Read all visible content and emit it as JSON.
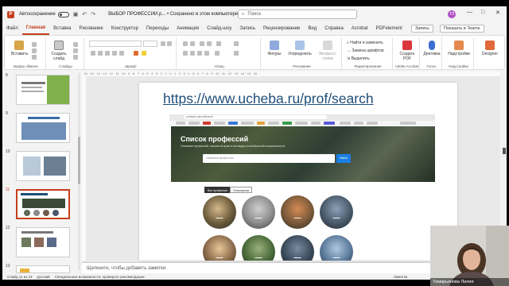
{
  "titlebar": {
    "autosave_label": "Автосохранение",
    "doc_title": "ВЫБОР ПРОФЕССИИ.p... • Сохранено в этом компьютере",
    "search_placeholder": "Поиск",
    "avatar_initials": "ТЛ"
  },
  "tabs": [
    "Файл",
    "Главная",
    "Вставка",
    "Рисование",
    "Конструктор",
    "Переходы",
    "Анимация",
    "Слайд-шоу",
    "Запись",
    "Рецензирование",
    "Вид",
    "Справка",
    "Acrobat",
    "PDFelement"
  ],
  "active_tab": "Главная",
  "tab_actions": {
    "record": "Запись",
    "present": "Показать в Teams"
  },
  "ribbon": {
    "paste": "Вставить",
    "new_slide": "Создать слайд",
    "shapes": "Фигуры",
    "arrange": "Упорядочить",
    "express_styles": "Экспресс-стили",
    "find": "Найти и заменить",
    "replace_fonts": "Замена шрифтов",
    "select": "Выделить",
    "create_pdf": "Создать PDF",
    "dictation": "Диктовка",
    "addins": "Надстройки",
    "designer": "Designer",
    "groups": {
      "clipboard": "Буфер обмена",
      "slides": "Слайды",
      "font": "Шрифт",
      "paragraph": "Абзац",
      "drawing": "Рисование",
      "editing": "Редактирование",
      "acrobat": "Adobe Acrobat",
      "voice": "Голос",
      "addins": "Надстройки"
    }
  },
  "ruler_text": "· 16 · 15 · 14 · 13 · 12 · 11 · 10 · 9 · 8 · 7 · 6 · 5 · 4 · 3 · 2 · 1 · 0 · 1 · 2 · 3 · 4 · 5 · 6 · 7 · 8 · 9 · 10 · 11 · 12 · 13 · 14 · 15 · 16 ·",
  "thumbnails": [
    {
      "num": "8"
    },
    {
      "num": "9"
    },
    {
      "num": "10"
    },
    {
      "num": "11"
    },
    {
      "num": "12"
    },
    {
      "num": "13"
    }
  ],
  "slide": {
    "url": "https://www.ucheba.ru/prof/search",
    "browser": {
      "address": "ucheba.ru/prof/search",
      "hero_title": "Список профессий",
      "hero_sub": "Описание профессий, ссылки на вузы и колледжи по выбранной специальности.",
      "search_placeholder": "Название профессии",
      "search_btn": "Найти",
      "pill_1": "Все профессии",
      "pill_2": "Популярные"
    }
  },
  "notes_placeholder": "Щелкните, чтобы добавить заметки",
  "status": {
    "slide_count": "Слайд 11 из 23",
    "language": "русский",
    "accessibility": "Специальные возможности: проверьте рекомендации",
    "notes_btn": "Заметки"
  },
  "webcam": {
    "name": "Тимирьянова Лилия"
  },
  "colors": {
    "accent": "#c43e1c",
    "link": "#1f4e79",
    "button": "#1a7fe5"
  }
}
